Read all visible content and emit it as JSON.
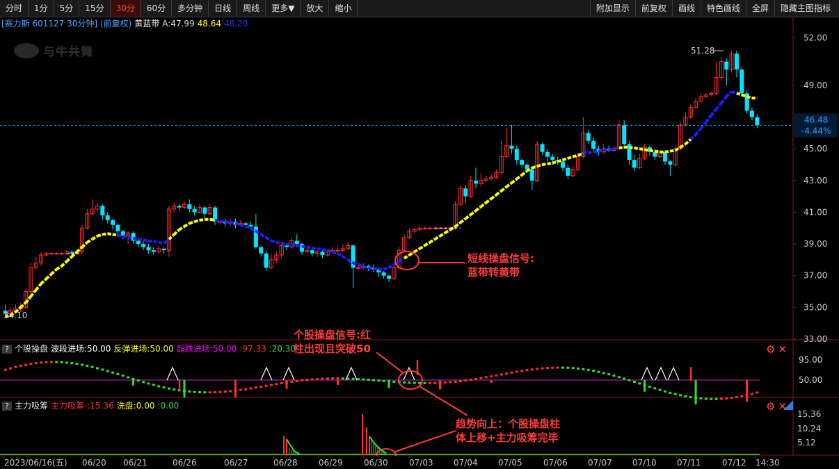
{
  "toolbar": {
    "left": [
      "分时",
      "1分",
      "5分",
      "15分",
      "30分",
      "60分",
      "多分钟",
      "日线",
      "周线",
      "更多▼",
      "放大",
      "缩小"
    ],
    "active": "30分",
    "right": [
      "附加显示",
      "前复权",
      "画线",
      "特色画线",
      "全屏",
      "隐藏主图指标"
    ]
  },
  "stock": {
    "header": "[赛力斯 601127 30分钟] (前复权)",
    "indicator_name": "黄蓝带",
    "a_label": "A:47.99",
    "val2": "48.64",
    "val3": "48.20",
    "watermark": "与牛共舞"
  },
  "main_axis": {
    "ticks": [
      "52.00",
      "49.00",
      "47.00",
      "45.00",
      "43.00",
      "41.00",
      "39.00",
      "37.00",
      "35.00",
      "33.00"
    ]
  },
  "main_labels": {
    "high_label": "51.28",
    "low_label": "34.10",
    "current_price": "46.48",
    "current_change": "-4.44%"
  },
  "panel2": {
    "name": "个股操盘",
    "items": [
      {
        "text": "波段进场:50.00",
        "color": "#ffffff"
      },
      {
        "text": "反弹进场:50.00",
        "color": "#ffff00"
      },
      {
        "text": "超跌进场:50.00",
        "color": "#ff00ff"
      },
      {
        "text": ":97.33",
        "color": "#ff3333"
      },
      {
        "text": ":20.30",
        "color": "#33dd33"
      }
    ],
    "ticks": [
      "95.00",
      "50.00"
    ]
  },
  "panel3": {
    "name": "主力吸筹",
    "items": [
      {
        "text": "主力吸筹-:15.36",
        "color": "#ff3333"
      },
      {
        "text": "洗盘:0.00",
        "color": "#ffff00"
      },
      {
        "text": ":0.00",
        "color": "#33dd33"
      }
    ],
    "ticks": [
      "15.36",
      "10.24",
      "5.12"
    ]
  },
  "dates": [
    "2023/06/16(五)",
    "06/20",
    "06/21",
    "06/26",
    "06/27",
    "06/28",
    "06/29",
    "06/30",
    "07/03",
    "07/04",
    "07/05",
    "07/06",
    "07/07",
    "07/10",
    "07/11",
    "07/12",
    "14:30"
  ],
  "annotations": {
    "a1_line1": "短线操盘信号:",
    "a1_line2": "蓝带转黄带",
    "a2_line1": "个股操盘信号:红",
    "a2_line2": "柱出现且突破50",
    "a3_line1": "趋势向上：个股操盘柱",
    "a3_line2": "体上移+主力吸筹完毕"
  },
  "colors": {
    "up": "#ff2e2e",
    "down": "#00e5ff",
    "yellow_band": "#ffff00",
    "blue_band": "#1e1eff",
    "annotation": "#ff3b3b",
    "grid": "#8a1515",
    "bg": "#000000"
  },
  "chart_data": {
    "type": "candlestick",
    "ylim": [
      33,
      52.5
    ],
    "candles": [
      [
        34.8,
        34.6,
        35.2,
        34.4
      ],
      [
        34.6,
        34.8,
        35.0,
        34.4
      ],
      [
        34.8,
        34.9,
        35.2,
        34.6
      ],
      [
        34.9,
        35.0,
        35.3,
        34.7
      ],
      [
        35.0,
        36.0,
        36.2,
        34.9
      ],
      [
        36.0,
        37.5,
        37.8,
        35.9
      ],
      [
        37.5,
        37.8,
        38.2,
        37.4
      ],
      [
        37.8,
        38.3,
        38.5,
        37.6
      ],
      [
        38.3,
        38.4,
        38.5,
        38.2
      ],
      [
        38.4,
        38.4,
        38.5,
        38.3
      ],
      [
        38.4,
        38.4,
        38.5,
        38.3
      ],
      [
        38.4,
        38.4,
        38.5,
        38.3
      ],
      [
        38.4,
        38.5,
        38.6,
        38.3
      ],
      [
        38.5,
        38.4,
        38.6,
        38.3
      ],
      [
        38.4,
        38.5,
        38.6,
        38.3
      ],
      [
        38.5,
        40.0,
        40.2,
        38.4
      ],
      [
        40.0,
        40.9,
        41.2,
        39.9
      ],
      [
        40.9,
        41.2,
        41.8,
        40.8
      ],
      [
        41.2,
        41.4,
        41.6,
        41.0
      ],
      [
        41.4,
        40.8,
        41.5,
        40.5
      ],
      [
        40.8,
        40.5,
        41.0,
        40.3
      ],
      [
        40.5,
        40.2,
        40.6,
        39.9
      ],
      [
        40.2,
        39.8,
        40.3,
        39.6
      ],
      [
        39.8,
        39.5,
        39.9,
        39.3
      ],
      [
        39.5,
        39.7,
        39.8,
        39.0
      ],
      [
        39.7,
        39.2,
        39.8,
        39.0
      ],
      [
        39.2,
        39.0,
        39.3,
        38.8
      ],
      [
        39.0,
        38.8,
        39.2,
        38.6
      ],
      [
        38.8,
        38.6,
        39.0,
        38.4
      ],
      [
        38.6,
        38.5,
        38.8,
        38.3
      ],
      [
        38.5,
        38.7,
        38.9,
        38.4
      ],
      [
        38.7,
        38.6,
        38.8,
        38.4
      ],
      [
        38.6,
        41.2,
        41.4,
        38.2
      ],
      [
        41.2,
        41.4,
        41.6,
        41.0
      ],
      [
        41.4,
        41.3,
        41.5,
        41.1
      ],
      [
        41.3,
        41.5,
        41.7,
        41.2
      ],
      [
        41.5,
        41.2,
        41.8,
        41.0
      ],
      [
        41.2,
        41.0,
        41.4,
        40.8
      ],
      [
        41.0,
        41.3,
        41.5,
        40.9
      ],
      [
        41.3,
        40.9,
        41.4,
        40.7
      ],
      [
        40.9,
        41.3,
        41.5,
        40.8
      ],
      [
        41.3,
        40.4,
        41.4,
        40.2
      ],
      [
        40.4,
        40.4,
        40.5,
        40.2
      ],
      [
        40.4,
        40.3,
        40.6,
        40.1
      ],
      [
        40.3,
        40.4,
        40.5,
        40.1
      ],
      [
        40.4,
        40.2,
        40.6,
        40.0
      ],
      [
        40.2,
        40.3,
        40.5,
        40.1
      ],
      [
        40.3,
        40.2,
        40.4,
        40.0
      ],
      [
        40.2,
        40.1,
        40.4,
        39.9
      ],
      [
        40.1,
        38.8,
        40.9,
        38.7
      ],
      [
        38.8,
        38.4,
        38.9,
        38.2
      ],
      [
        38.4,
        37.5,
        38.6,
        37.3
      ],
      [
        37.5,
        38.0,
        38.4,
        37.4
      ],
      [
        38.0,
        38.3,
        38.5,
        37.8
      ],
      [
        38.3,
        38.9,
        39.0,
        38.1
      ],
      [
        38.9,
        38.8,
        39.0,
        38.6
      ],
      [
        38.8,
        39.2,
        39.4,
        38.7
      ],
      [
        39.2,
        39.0,
        39.6,
        38.8
      ],
      [
        39.0,
        38.5,
        39.1,
        38.3
      ],
      [
        38.5,
        38.6,
        38.8,
        38.4
      ],
      [
        38.6,
        38.4,
        38.7,
        38.2
      ],
      [
        38.4,
        38.5,
        38.6,
        38.2
      ],
      [
        38.5,
        38.3,
        38.6,
        38.1
      ],
      [
        38.3,
        38.5,
        38.7,
        38.2
      ],
      [
        38.5,
        38.6,
        38.8,
        38.4
      ],
      [
        38.6,
        38.6,
        38.8,
        38.4
      ],
      [
        38.6,
        38.7,
        39.0,
        38.5
      ],
      [
        38.7,
        38.9,
        39.1,
        38.6
      ],
      [
        38.9,
        37.5,
        39.0,
        36.2
      ],
      [
        37.5,
        37.5,
        37.8,
        37.3
      ],
      [
        37.5,
        37.6,
        37.8,
        37.4
      ],
      [
        37.6,
        37.5,
        37.7,
        37.3
      ],
      [
        37.5,
        37.4,
        37.7,
        37.2
      ],
      [
        37.4,
        37.2,
        37.5,
        36.9
      ],
      [
        37.2,
        37.0,
        37.3,
        36.8
      ],
      [
        37.0,
        36.8,
        37.1,
        36.6
      ],
      [
        36.8,
        37.5,
        37.7,
        36.7
      ],
      [
        37.5,
        38.6,
        38.8,
        37.4
      ],
      [
        38.6,
        39.4,
        39.6,
        38.5
      ],
      [
        39.4,
        39.8,
        40.0,
        39.3
      ],
      [
        39.8,
        39.9,
        40.0,
        39.7
      ],
      [
        39.9,
        40.0,
        40.1,
        39.8
      ],
      [
        40.0,
        40.0,
        40.1,
        39.9
      ],
      [
        40.0,
        40.0,
        40.1,
        39.9
      ],
      [
        40.0,
        40.0,
        40.1,
        39.9
      ],
      [
        40.0,
        40.0,
        40.1,
        39.9
      ],
      [
        40.0,
        40.0,
        40.1,
        39.9
      ],
      [
        40.0,
        40.0,
        40.1,
        39.9
      ],
      [
        40.0,
        41.5,
        41.7,
        39.9
      ],
      [
        41.5,
        42.5,
        42.7,
        41.4
      ],
      [
        42.5,
        42.0,
        42.7,
        41.6
      ],
      [
        42.0,
        43.0,
        43.3,
        41.9
      ],
      [
        43.0,
        42.8,
        43.8,
        42.5
      ],
      [
        42.8,
        43.0,
        43.5,
        42.6
      ],
      [
        43.0,
        43.1,
        43.3,
        42.9
      ],
      [
        43.1,
        43.2,
        43.4,
        43.0
      ],
      [
        43.2,
        43.5,
        43.7,
        43.1
      ],
      [
        43.5,
        44.5,
        45.5,
        43.4
      ],
      [
        44.5,
        45.2,
        46.3,
        44.4
      ],
      [
        45.2,
        45.0,
        46.5,
        44.7
      ],
      [
        45.0,
        44.3,
        45.2,
        44.0
      ],
      [
        44.3,
        44.0,
        44.4,
        43.8
      ],
      [
        44.0,
        43.7,
        44.1,
        43.5
      ],
      [
        43.7,
        43.0,
        43.9,
        42.4
      ],
      [
        43.0,
        45.3,
        45.5,
        42.9
      ],
      [
        45.3,
        44.8,
        45.4,
        44.6
      ],
      [
        44.8,
        44.5,
        45.0,
        44.2
      ],
      [
        44.5,
        44.3,
        44.7,
        44.0
      ],
      [
        44.3,
        44.2,
        44.5,
        44.0
      ],
      [
        44.2,
        43.8,
        44.3,
        43.6
      ],
      [
        43.8,
        43.3,
        44.0,
        43.1
      ],
      [
        43.3,
        43.7,
        43.9,
        43.2
      ],
      [
        43.7,
        44.5,
        44.7,
        43.6
      ],
      [
        44.5,
        46.0,
        47.0,
        44.4
      ],
      [
        46.0,
        45.5,
        46.2,
        45.3
      ],
      [
        45.5,
        45.0,
        45.7,
        44.8
      ],
      [
        45.0,
        44.8,
        45.2,
        44.6
      ],
      [
        44.8,
        45.0,
        45.3,
        44.7
      ],
      [
        45.0,
        44.9,
        45.2,
        44.8
      ],
      [
        44.9,
        45.0,
        45.2,
        44.8
      ],
      [
        45.0,
        46.5,
        46.8,
        44.9
      ],
      [
        46.5,
        45.3,
        46.8,
        45.0
      ],
      [
        45.3,
        44.3,
        45.5,
        44.0
      ],
      [
        44.3,
        43.8,
        44.6,
        43.6
      ],
      [
        43.8,
        44.4,
        44.7,
        43.7
      ],
      [
        44.4,
        45.1,
        45.3,
        44.3
      ],
      [
        45.1,
        44.8,
        45.2,
        44.6
      ],
      [
        44.8,
        44.5,
        45.0,
        44.3
      ],
      [
        44.5,
        44.8,
        44.9,
        44.4
      ],
      [
        44.8,
        44.2,
        44.9,
        44.0
      ],
      [
        44.2,
        44.0,
        44.3,
        43.3
      ],
      [
        44.0,
        45.0,
        45.2,
        43.9
      ],
      [
        45.0,
        46.5,
        46.7,
        44.9
      ],
      [
        46.5,
        47.0,
        47.3,
        46.4
      ],
      [
        47.0,
        47.6,
        47.8,
        46.9
      ],
      [
        47.6,
        48.0,
        48.2,
        47.5
      ],
      [
        48.0,
        48.3,
        48.5,
        47.9
      ],
      [
        48.3,
        48.4,
        48.5,
        48.2
      ],
      [
        48.4,
        48.5,
        48.6,
        48.3
      ],
      [
        48.5,
        49.5,
        50.5,
        48.4
      ],
      [
        49.5,
        50.5,
        50.8,
        49.3
      ],
      [
        50.5,
        50.0,
        50.7,
        49.0
      ],
      [
        50.0,
        51.0,
        51.2,
        49.8
      ],
      [
        51.0,
        50.0,
        51.2,
        49.5
      ],
      [
        50.0,
        48.5,
        50.2,
        48.3
      ],
      [
        48.5,
        47.4,
        48.7,
        47.2
      ],
      [
        47.4,
        47.0,
        47.6,
        46.8
      ],
      [
        47.0,
        46.48,
        47.2,
        46.3
      ]
    ],
    "band": [
      34.4,
      34.5,
      34.7,
      35.0,
      35.3,
      35.7,
      36.1,
      36.5,
      36.8,
      37.1,
      37.4,
      37.6,
      37.9,
      38.2,
      38.5,
      38.8,
      39.1,
      39.3,
      39.5,
      39.6,
      39.65,
      39.6,
      39.55,
      39.5,
      39.4,
      39.35,
      39.3,
      39.25,
      39.2,
      39.15,
      39.1,
      39.05,
      39.3,
      39.6,
      39.9,
      40.1,
      40.3,
      40.4,
      40.5,
      40.55,
      40.55,
      40.5,
      40.45,
      40.4,
      40.35,
      40.3,
      40.2,
      40.1,
      40.0,
      39.8,
      39.6,
      39.4,
      39.2,
      39.1,
      39.05,
      39.0,
      38.95,
      38.9,
      38.85,
      38.8,
      38.75,
      38.7,
      38.65,
      38.6,
      38.5,
      38.4,
      38.2,
      38.0,
      37.8,
      37.7,
      37.6,
      37.5,
      37.45,
      37.4,
      37.4,
      37.5,
      37.7,
      37.9,
      38.1,
      38.3,
      38.5,
      38.7,
      38.9,
      39.1,
      39.3,
      39.5,
      39.7,
      39.9,
      40.1,
      40.35,
      40.6,
      40.85,
      41.1,
      41.35,
      41.6,
      41.85,
      42.1,
      42.35,
      42.6,
      42.85,
      43.1,
      43.35,
      43.6,
      43.8,
      43.9,
      44.0,
      44.05,
      44.1,
      44.2,
      44.3,
      44.4,
      44.5,
      44.6,
      44.7,
      44.75,
      44.8,
      44.85,
      44.9,
      44.95,
      45.0,
      45.05,
      45.1,
      45.1,
      45.05,
      45.0,
      44.95,
      44.9,
      44.85,
      44.8,
      44.8,
      44.85,
      44.9,
      45.1,
      45.3,
      45.6,
      45.9,
      46.3,
      46.7,
      47.1,
      47.5,
      47.9,
      48.3,
      48.6,
      48.5,
      48.4,
      48.3,
      48.2,
      48.2
    ],
    "band_colors": "yyyyyyyyyyyyyyyyyyyyyybbbbbbbbbbyyyyyyyyybbbbbbbbbbbbbbbbbbbbbbbbbbbbbbbbbbbbbyyyyyyyyyyyyyyyyyyyyyyyyyyyyyyyyyyybbbbbbbyyyyyyyyyyyyyybbbbbbbbbyyyyyyyyyyyyyybbbb"
  }
}
